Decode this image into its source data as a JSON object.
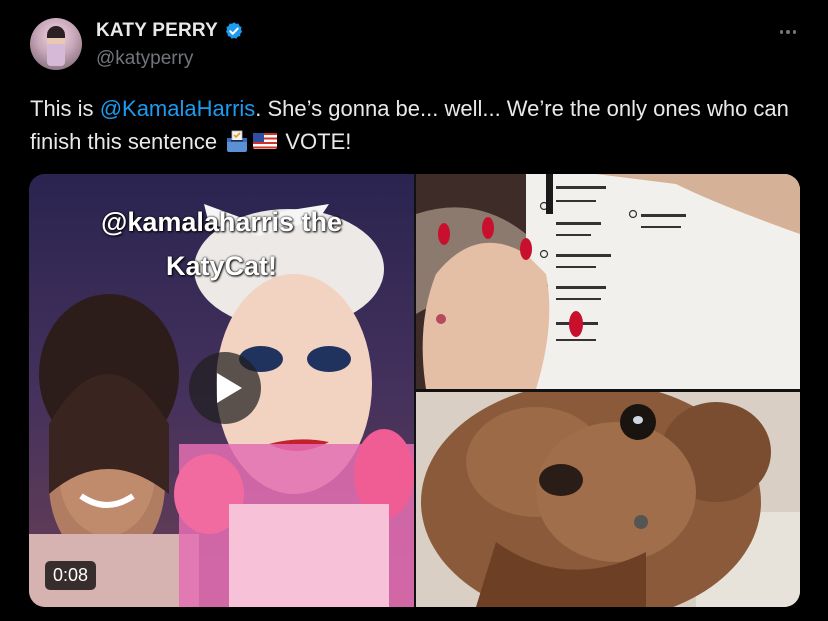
{
  "author": {
    "display_name": "KATY PERRY",
    "handle": "@katyperry",
    "verified": true,
    "verified_color": "#1d9bf0"
  },
  "tweet": {
    "text_before_mention": "This is ",
    "mention": "@KamalaHarris",
    "text_after_mention": ". She’s gonna be... well... We’re the only ones who can finish this sentence ",
    "emoji_1": "ballot-box-emoji",
    "emoji_2": "us-flag-emoji",
    "text_end": " VOTE!"
  },
  "media": {
    "video": {
      "caption_line_1": "@kamalaharris the",
      "caption_line_2": "KatyCat!",
      "duration": "0:08"
    },
    "photo_1_subject": "ballot-photo",
    "photo_2_subject": "poodle-photo"
  },
  "colors": {
    "background": "#000000",
    "text": "#e7e9ea",
    "secondary_text": "#71767b",
    "link": "#1d9bf0"
  },
  "icons": {
    "more": "more-horizontal-icon",
    "verified": "verified-badge-icon",
    "play": "play-icon"
  }
}
